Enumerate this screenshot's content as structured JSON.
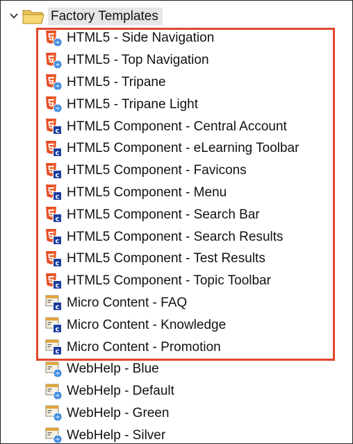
{
  "root": {
    "label": "Factory Templates",
    "expanded": true,
    "icon": "folder-open-icon"
  },
  "highlight_color": "#e0462b",
  "items": [
    {
      "label": "HTML5 - Side Navigation",
      "icon": "html5-template-icon"
    },
    {
      "label": "HTML5 - Top Navigation",
      "icon": "html5-template-icon"
    },
    {
      "label": "HTML5 - Tripane",
      "icon": "html5-template-icon"
    },
    {
      "label": "HTML5 - Tripane Light",
      "icon": "html5-template-icon"
    },
    {
      "label": "HTML5 Component - Central Account",
      "icon": "html5-component-icon"
    },
    {
      "label": "HTML5 Component - eLearning Toolbar",
      "icon": "html5-component-icon"
    },
    {
      "label": "HTML5 Component - Favicons",
      "icon": "html5-component-icon"
    },
    {
      "label": "HTML5 Component - Menu",
      "icon": "html5-component-icon"
    },
    {
      "label": "HTML5 Component - Search Bar",
      "icon": "html5-component-icon"
    },
    {
      "label": "HTML5 Component - Search Results",
      "icon": "html5-component-icon"
    },
    {
      "label": "HTML5 Component - Test Results",
      "icon": "html5-component-icon"
    },
    {
      "label": "HTML5 Component - Topic Toolbar",
      "icon": "html5-component-icon"
    },
    {
      "label": "Micro Content - FAQ",
      "icon": "micro-content-icon"
    },
    {
      "label": "Micro Content - Knowledge",
      "icon": "micro-content-icon"
    },
    {
      "label": "Micro Content - Promotion",
      "icon": "micro-content-icon"
    },
    {
      "label": "WebHelp - Blue",
      "icon": "webhelp-template-icon"
    },
    {
      "label": "WebHelp - Default",
      "icon": "webhelp-template-icon"
    },
    {
      "label": "WebHelp - Green",
      "icon": "webhelp-template-icon"
    },
    {
      "label": "WebHelp - Silver",
      "icon": "webhelp-template-icon"
    }
  ]
}
